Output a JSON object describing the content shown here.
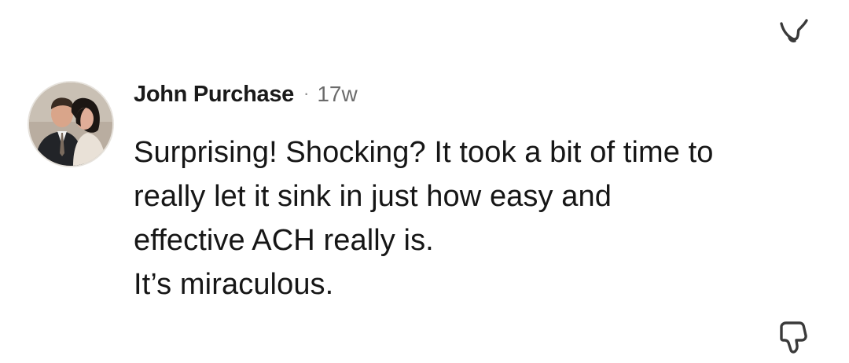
{
  "comment": {
    "author": "John Purchase",
    "separator": "·",
    "time": "17w",
    "lines": [
      "Surprising! Shocking? It took a bit of time to",
      "really let it sink in just how easy and",
      "effective ACH really is.",
      "It’s miraculous."
    ]
  },
  "icons": {
    "top_right": "partial-thumbs-down-icon",
    "bottom_right": "thumbs-down-icon",
    "avatar": "user-avatar"
  },
  "colors": {
    "text": "#161616",
    "meta": "#6b6b6b",
    "icon": "#3a3a3a"
  }
}
